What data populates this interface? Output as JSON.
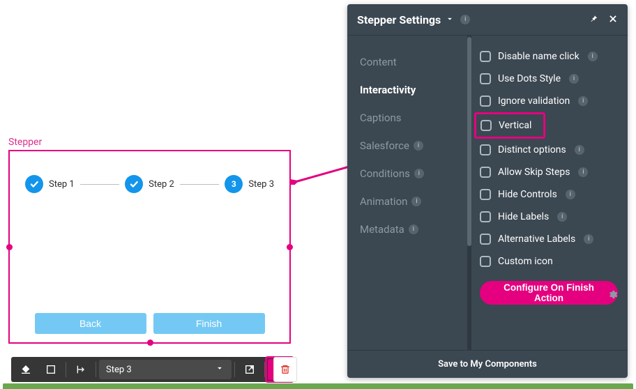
{
  "canvas": {
    "label": "Stepper",
    "steps": [
      {
        "label": "Step 1",
        "state": "done"
      },
      {
        "label": "Step 2",
        "state": "done"
      },
      {
        "label": "Step 3",
        "state": "current",
        "num": "3"
      }
    ],
    "backLabel": "Back",
    "finishLabel": "Finish"
  },
  "toolbar": {
    "selectValue": "Step 3"
  },
  "panel": {
    "title": "Stepper Settings",
    "tabs": [
      {
        "label": "Content",
        "info": false
      },
      {
        "label": "Interactivity",
        "info": false,
        "active": true
      },
      {
        "label": "Captions",
        "info": false
      },
      {
        "label": "Salesforce",
        "info": true
      },
      {
        "label": "Conditions",
        "info": true
      },
      {
        "label": "Animation",
        "info": true
      },
      {
        "label": "Metadata",
        "info": true
      }
    ],
    "options": [
      {
        "label": "Disable name click",
        "info": true
      },
      {
        "label": "Use Dots Style",
        "info": true
      },
      {
        "label": "Ignore validation",
        "info": true
      },
      {
        "label": "Vertical",
        "info": false,
        "highlight": true
      },
      {
        "label": "Distinct options",
        "info": true
      },
      {
        "label": "Allow Skip Steps",
        "info": true
      },
      {
        "label": "Hide Controls",
        "info": true
      },
      {
        "label": "Hide Labels",
        "info": true
      },
      {
        "label": "Alternative Labels",
        "info": true
      },
      {
        "label": "Custom icon",
        "info": false,
        "gear": true
      }
    ],
    "configureBtn": "Configure On Finish Action",
    "footer": "Save to My Components"
  }
}
